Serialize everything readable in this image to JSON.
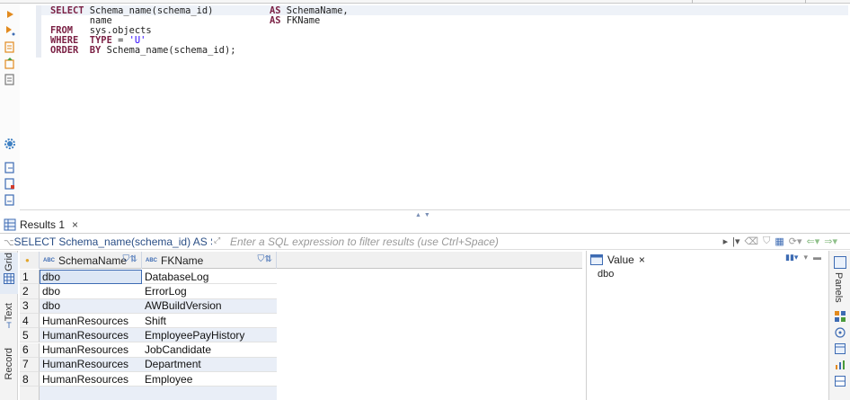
{
  "editor": {
    "lines": [
      [
        {
          "t": "SELECT",
          "k": "kw"
        },
        {
          "t": " Schema_name(schema_id)          "
        },
        {
          "t": "AS",
          "k": "kw"
        },
        {
          "t": " SchemaName,"
        }
      ],
      [
        {
          "t": "       name                            "
        },
        {
          "t": "AS",
          "k": "kw"
        },
        {
          "t": " FKName"
        }
      ],
      [
        {
          "t": "FROM",
          "k": "kw"
        },
        {
          "t": "   sys.objects"
        }
      ],
      [
        {
          "t": "WHERE",
          "k": "kw"
        },
        {
          "t": "  "
        },
        {
          "t": "TYPE",
          "k": "kw"
        },
        {
          "t": " = "
        },
        {
          "t": "'U'",
          "k": "str"
        }
      ],
      [
        {
          "t": "ORDER",
          "k": "kw"
        },
        {
          "t": "  "
        },
        {
          "t": "BY",
          "k": "kw"
        },
        {
          "t": " Schema_name(schema_id);"
        }
      ]
    ],
    "gutter_icons": [
      "execute-statement-icon",
      "execute-script-icon",
      "explain-plan-icon",
      "load-plan-icon",
      "history-icon",
      "settings-icon",
      "export-icon",
      "new-script-icon",
      "sql-file-icon"
    ]
  },
  "results_tab": {
    "label": "Results 1",
    "close": "×"
  },
  "filter": {
    "query_label": "SELECT Schema_name(schema_id) AS Sch",
    "placeholder": "Enter a SQL expression to filter results (use Ctrl+Space)"
  },
  "vertical_tabs": {
    "grid": "Grid",
    "text": "Text",
    "record": "Record"
  },
  "grid": {
    "columns": [
      {
        "badge": "ABC",
        "label": "SchemaName"
      },
      {
        "badge": "ABC",
        "label": "FKName"
      }
    ],
    "rows": [
      {
        "num": "1",
        "schema": "dbo",
        "name": "DatabaseLog"
      },
      {
        "num": "2",
        "schema": "dbo",
        "name": "ErrorLog"
      },
      {
        "num": "3",
        "schema": "dbo",
        "name": "AWBuildVersion"
      },
      {
        "num": "4",
        "schema": "HumanResources",
        "name": "Shift"
      },
      {
        "num": "5",
        "schema": "HumanResources",
        "name": "EmployeePayHistory"
      },
      {
        "num": "6",
        "schema": "HumanResources",
        "name": "JobCandidate"
      },
      {
        "num": "7",
        "schema": "HumanResources",
        "name": "Department"
      },
      {
        "num": "8",
        "schema": "HumanResources",
        "name": "Employee"
      }
    ]
  },
  "value_panel": {
    "tab_label": "Value",
    "close": "×",
    "value": "dbo"
  },
  "panels_strip": {
    "label": "Panels"
  },
  "colors": {
    "keyword": "#7a1f43",
    "string": "#2a00ff",
    "accent": "#3d6bb3",
    "alt_row": "#e9eef7"
  }
}
